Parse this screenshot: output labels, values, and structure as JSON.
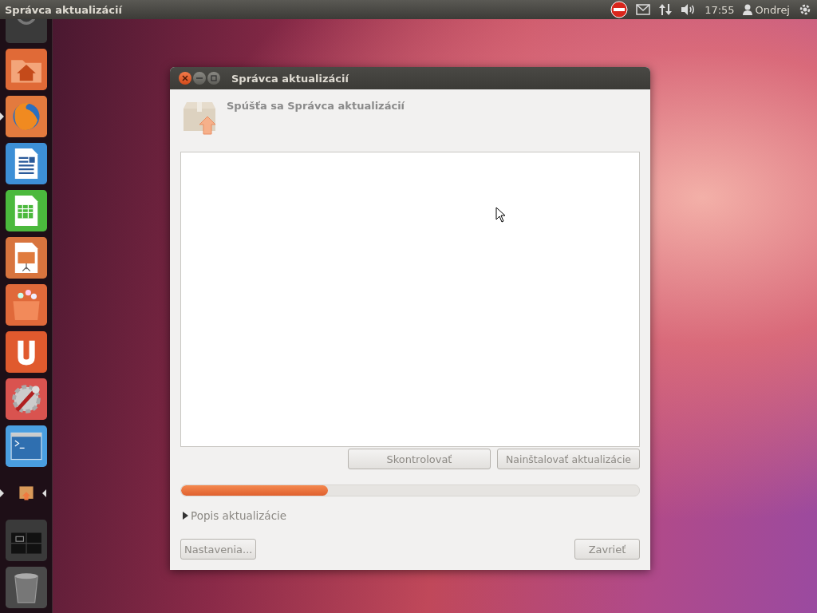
{
  "top_bar": {
    "app_title": "Správca aktualizácií",
    "clock": "17:55",
    "user": "Ondrej"
  },
  "launcher": [
    {
      "kind": "dash",
      "color": "#3a3a3a",
      "running": false,
      "focused": false
    },
    {
      "kind": "home",
      "color": "#e06a37",
      "running": false,
      "focused": false
    },
    {
      "kind": "browser",
      "color": "#e37a3e",
      "running": true,
      "focused": false
    },
    {
      "kind": "writer",
      "color": "#3d8fd6",
      "running": false,
      "focused": false
    },
    {
      "kind": "calc",
      "color": "#4bb93d",
      "running": false,
      "focused": false
    },
    {
      "kind": "impress",
      "color": "#d8743e",
      "running": false,
      "focused": false
    },
    {
      "kind": "store",
      "color": "#e0693a",
      "running": false,
      "focused": false
    },
    {
      "kind": "ubuntuone",
      "color": "#e05a2e",
      "running": false,
      "focused": false
    },
    {
      "kind": "settings",
      "color": "#d9534f",
      "running": false,
      "focused": false
    },
    {
      "kind": "terminal",
      "color": "#4a9ee0",
      "running": false,
      "focused": false
    },
    {
      "kind": "updates",
      "running": true,
      "focused": true
    },
    {
      "kind": "workspaces",
      "color": "#3a3a3a",
      "running": false,
      "focused": false
    },
    {
      "kind": "trash",
      "color": "#4a4a4a",
      "running": false,
      "focused": false
    }
  ],
  "window": {
    "title": "Správca aktualizácií",
    "heading": "Spúšťa sa Správca aktualizácií",
    "action_buttons": [
      {
        "label": "Skontrolovať",
        "disabled": true
      },
      {
        "label": "Nainštalovať aktualizácie",
        "disabled": true
      }
    ],
    "progress": {
      "level": 0.32
    },
    "expander": {
      "label": "Popis aktualizácie",
      "expanded": false
    },
    "footer_buttons": [
      {
        "label": "Nastavenia...",
        "disabled": true
      },
      {
        "label": "Zavrieť",
        "disabled": true
      }
    ]
  }
}
